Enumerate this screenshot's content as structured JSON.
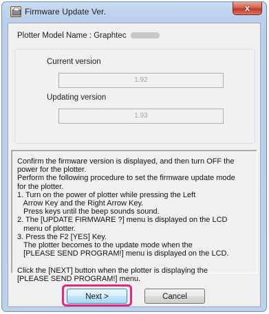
{
  "window": {
    "title": "Firmware Update Ver.",
    "close_symbol": "x",
    "icon": "firmware-app-icon"
  },
  "model": {
    "label": "Plotter Model Name : Graphtec",
    "value_note": "redacted model number"
  },
  "versions": {
    "current_label": "Current version",
    "current_value": "1.92",
    "updating_label": "Updating version",
    "updating_value": "1.93"
  },
  "instructions": [
    "Confirm the firmware version is displayed, and then turn OFF the",
    "power for the plotter.",
    "Perform the following procedure to set the firmware update mode",
    "for the plotter.",
    "1. Turn on the power of plotter while pressing the Left",
    "   Arrow Key and the Right Arrow Key.",
    "   Press keys until the beep sounds sound.",
    "2. The [UPDATE FIRMWARE ?] menu is displayed on the LCD",
    "   menu of plotter.",
    "3. Press the F2 [YES] Key.",
    "   The plotter becomes to the update mode when the",
    "   [PLEASE SEND PROGRAM!] menu is displayed on the LCD.",
    "",
    "Click the [NEXT] button when the plotter is displaying the",
    "[PLEASE SEND PROGRAM!] menu."
  ],
  "buttons": {
    "next": "Next >",
    "cancel": "Cancel"
  },
  "colors": {
    "highlight": "#e0287e",
    "title_bar": "#b9cfea",
    "close_button": "#c0392b",
    "dialog_background": "#f0f0f0"
  }
}
